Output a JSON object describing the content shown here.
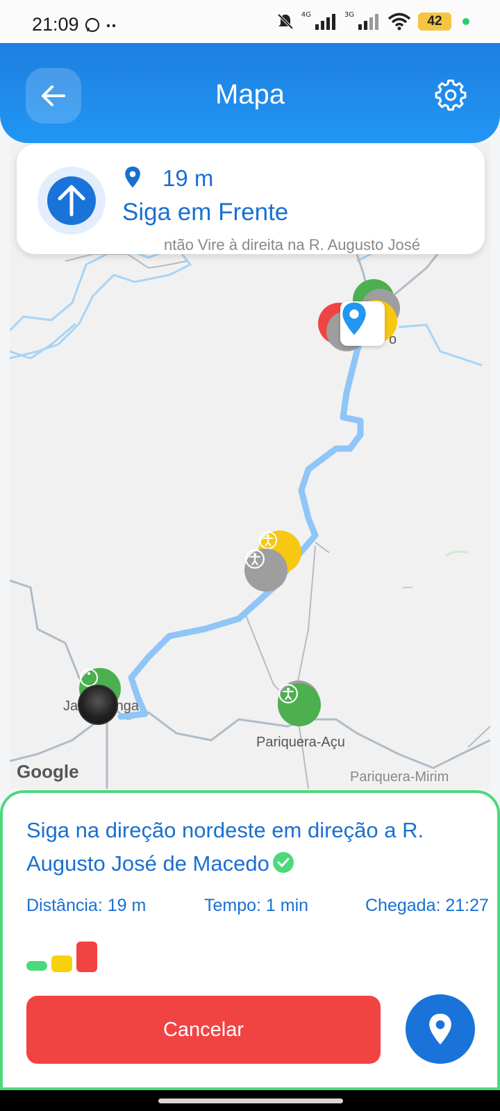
{
  "status_bar": {
    "time": "21:09",
    "battery": "42",
    "net1": "4G",
    "net2": "3G",
    "icons": [
      "whatsapp-icon",
      "more-dots-icon",
      "mute-icon",
      "signal-icon",
      "wifi-icon",
      "battery-icon"
    ]
  },
  "header": {
    "title": "Mapa",
    "back_icon": "arrow-left-icon",
    "settings_icon": "gear-icon",
    "color": "#1e88e5"
  },
  "instruction": {
    "distance": "19 m",
    "text": "Siga em Frente",
    "next_preview": "ntão Vire à direita na R. Augusto José",
    "icon": "arrow-up-icon"
  },
  "map": {
    "labels": {
      "city1": "Jacupiranga",
      "city2": "Pariquera-Açu",
      "city3": "Pariquera-Mirim",
      "partial": "o",
      "watermark": "Google"
    },
    "route_color": "#8fc5f7"
  },
  "bottom": {
    "title": "Siga na direção nordeste em direção a R. Augusto José de Macedo",
    "distance": "Distância: 19 m",
    "time": "Tempo: 1 min",
    "arrival": "Chegada: 21:27",
    "cancel_label": "Cancelar",
    "status_colors": [
      "#4cd97b",
      "#f7d10a",
      "#f24343"
    ]
  }
}
